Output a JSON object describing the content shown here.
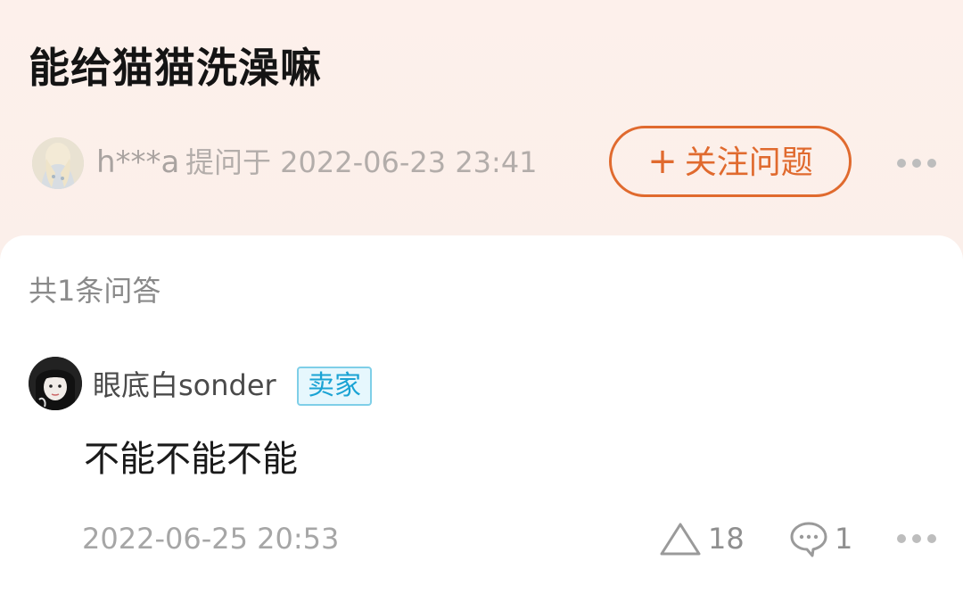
{
  "question": {
    "title": "能给猫猫洗澡嘛",
    "asker_name": "h***a",
    "asked_meta": "提问于 2022-06-23 23:41",
    "follow_label": "关注问题",
    "follow_icon": "plus-icon",
    "more_icon": "more-dots-icon"
  },
  "answers_section": {
    "count_label": "共1条问答"
  },
  "answer": {
    "answerer_name": "眼底白sonder",
    "badge": "卖家",
    "content": "不能不能不能",
    "time": "2022-06-25 20:53",
    "like_count": "18",
    "comment_count": "1",
    "like_icon": "triangle-like-icon",
    "comment_icon": "comment-bubble-icon",
    "more_icon": "more-dots-icon"
  },
  "colors": {
    "header_bg": "#fdf0eb",
    "accent": "#e06a2e",
    "badge_text": "#1aa3d4",
    "badge_border": "#7fcfe8",
    "badge_bg": "#e6f7fd",
    "muted_text": "#a6a6a6"
  }
}
